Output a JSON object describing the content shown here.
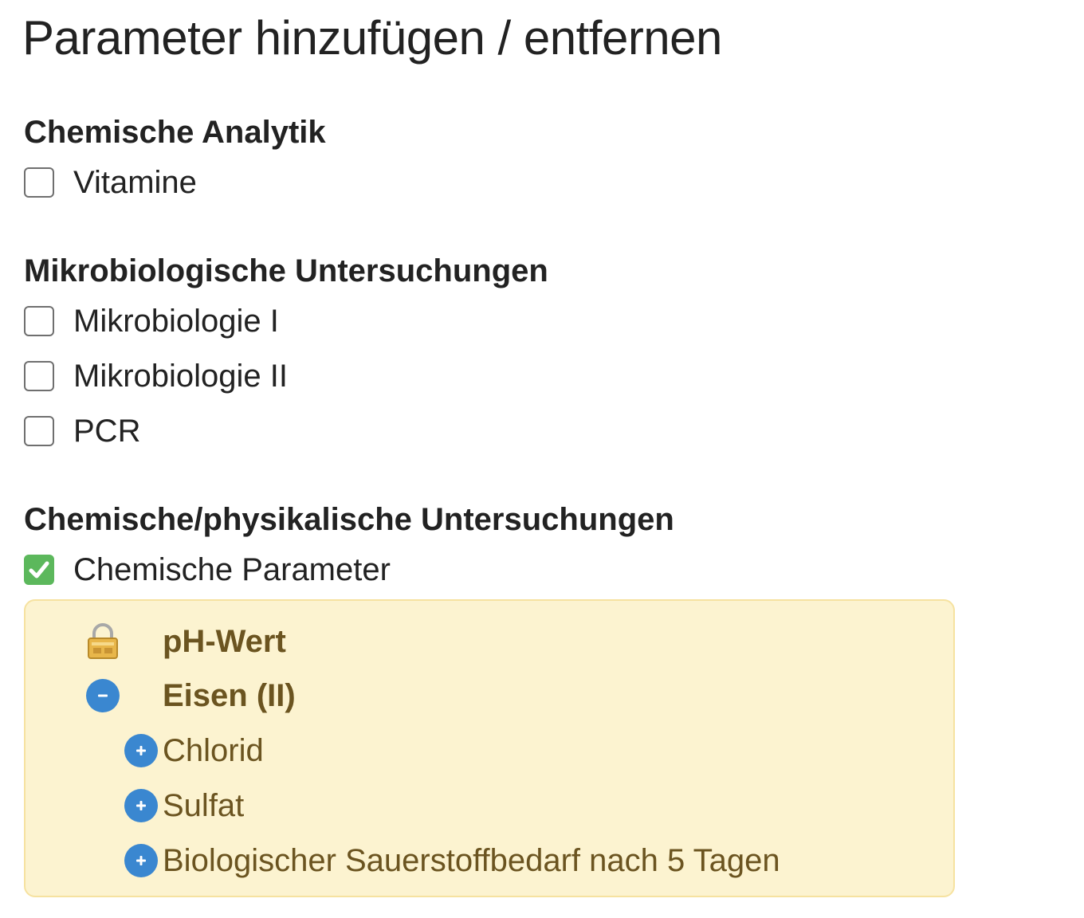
{
  "title": "Parameter hinzufügen / entfernen",
  "sections": [
    {
      "heading": "Chemische Analytik",
      "items": [
        {
          "label": "Vitamine",
          "checked": false
        }
      ]
    },
    {
      "heading": "Mikrobiologische Untersuchungen",
      "items": [
        {
          "label": "Mikrobiologie I",
          "checked": false
        },
        {
          "label": "Mikrobiologie II",
          "checked": false
        },
        {
          "label": "PCR",
          "checked": false
        }
      ]
    },
    {
      "heading": "Chemische/physikalische Untersuchungen",
      "items": [
        {
          "label": "Chemische Parameter",
          "checked": true
        }
      ]
    }
  ],
  "parameters": {
    "selected": [
      {
        "label": "pH-Wert",
        "icon": "lock-icon",
        "state": "locked"
      },
      {
        "label": "Eisen (II)",
        "icon": "minus-circle-icon",
        "state": "selected"
      }
    ],
    "available": [
      {
        "label": "Chlorid",
        "icon": "plus-circle-icon"
      },
      {
        "label": "Sulfat",
        "icon": "plus-circle-icon"
      },
      {
        "label": "Biologischer Sauerstoffbedarf nach 5 Tagen",
        "icon": "plus-circle-icon"
      }
    ]
  },
  "colors": {
    "checkbox_checked": "#5cb85c",
    "panel_background": "#fcf3d0",
    "panel_border": "#f6e2a0",
    "panel_text": "#6b5420",
    "action_button": "#3a87d0"
  }
}
